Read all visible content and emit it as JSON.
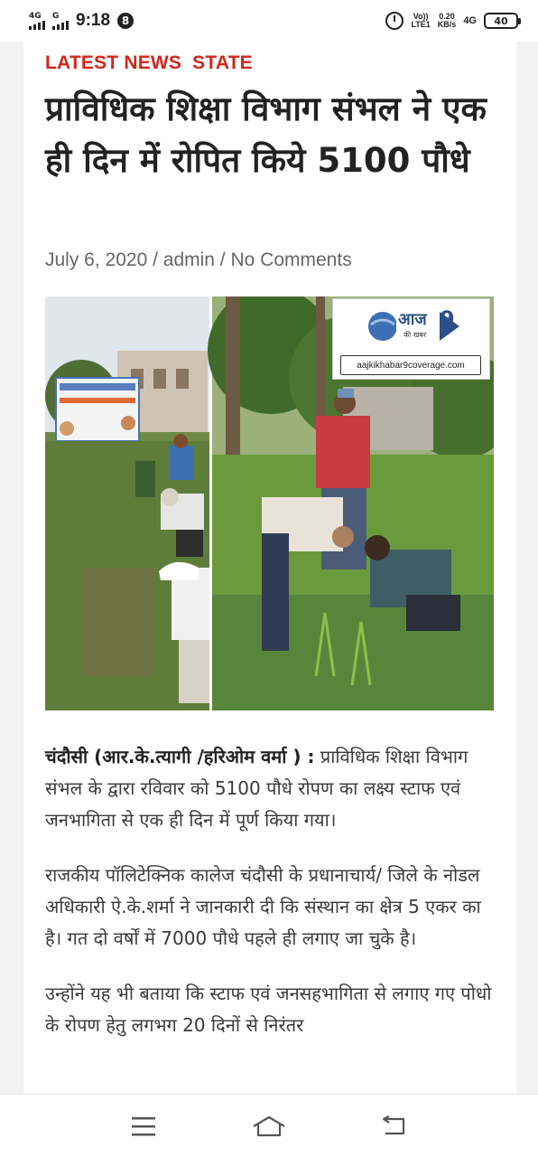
{
  "status_bar": {
    "network_label": "4G",
    "network_label_2": "G",
    "time": "9:18",
    "notification_count": "8",
    "volte": "Vo))",
    "lte": "LTE1",
    "speed_value": "0.20",
    "speed_unit": "KB/s",
    "net_right": "4G",
    "battery": "40"
  },
  "article": {
    "categories": [
      "LATEST NEWS",
      "STATE"
    ],
    "title": "प्राविधिक शिक्षा विभाग संभल ने एक ही दिन में रोपित किये 5100 पौधे",
    "date": "July 6, 2020",
    "separator": " / ",
    "author": "admin",
    "comments": "No Comments",
    "image_logo_title": "आज",
    "image_logo_sub": "की खबर",
    "image_logo_num": "9",
    "image_logo_url": "aajkikhabar9coverage.com",
    "paragraph_1_lead": "चंदौसी (आर.के.त्यागी /हरिओम वर्मा ) :",
    "paragraph_1_text": " प्राविधिक शिक्षा विभाग संभल के द्वारा रविवार को 5100 पौधे रोपण का लक्ष्य स्टाफ एवं जनभागिता से एक ही दिन में पूर्ण किया गया।",
    "paragraph_2": "राजकीय पॉलिटेक्निक कालेज चंदौसी के प्रधानाचार्य/ जिले के नोडल अधिकारी  ऐ.के.शर्मा ने जानकारी दी कि संस्थान का क्षेत्र 5 एकर का है। गत दो वर्षों में 7000 पौधे पहले ही लगाए जा चुके है।",
    "paragraph_3": "उन्होंने यह भी बताया कि स्टाफ एवं जनसहभागिता से लगाए गए पोधो के रोपण हेतु लगभग 20 दिनों से निरंतर"
  },
  "colors": {
    "category": "#d0271d",
    "title": "#222222",
    "meta": "#666666"
  },
  "nav": {
    "menu_icon": "menu-icon",
    "home_icon": "home-icon",
    "back_icon": "back-icon"
  }
}
